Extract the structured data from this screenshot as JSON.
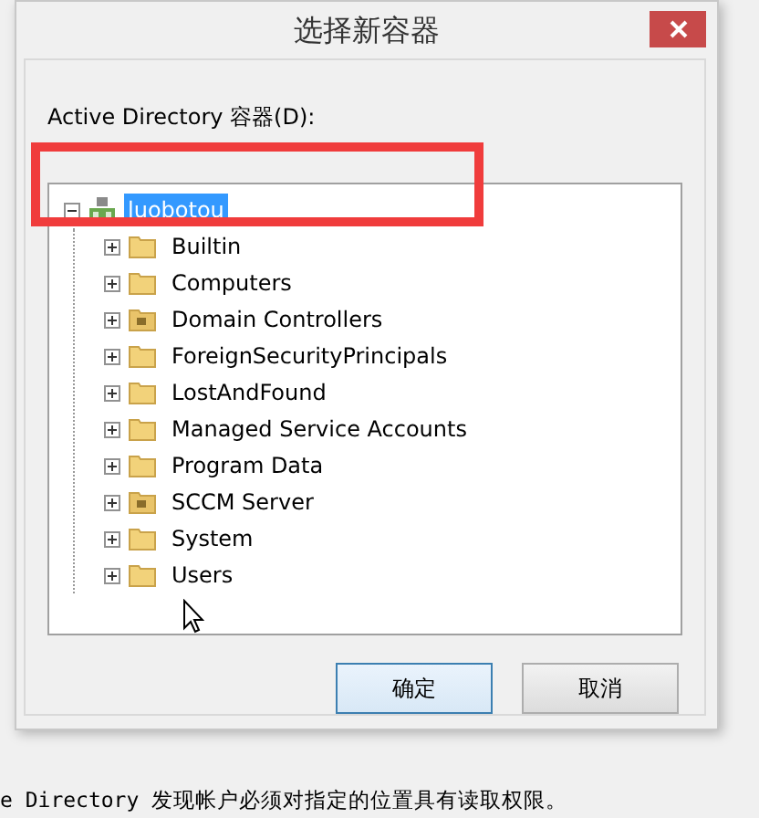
{
  "window": {
    "title": "选择新容器"
  },
  "label": "Active Directory 容器(D):",
  "tree": {
    "label": "luobotou",
    "selected": true,
    "expanded": true,
    "kind": "domain",
    "children": [
      {
        "label": "Builtin",
        "kind": "container",
        "expanded": false,
        "selected": false
      },
      {
        "label": "Computers",
        "kind": "container",
        "expanded": false,
        "selected": false
      },
      {
        "label": "Domain Controllers",
        "kind": "ou",
        "expanded": false,
        "selected": false
      },
      {
        "label": "ForeignSecurityPrincipals",
        "kind": "container",
        "expanded": false,
        "selected": false
      },
      {
        "label": "LostAndFound",
        "kind": "container",
        "expanded": false,
        "selected": false
      },
      {
        "label": "Managed Service Accounts",
        "kind": "container",
        "expanded": false,
        "selected": false
      },
      {
        "label": "Program Data",
        "kind": "container",
        "expanded": false,
        "selected": false
      },
      {
        "label": "SCCM Server",
        "kind": "ou",
        "expanded": false,
        "selected": false
      },
      {
        "label": "System",
        "kind": "container",
        "expanded": false,
        "selected": false
      },
      {
        "label": "Users",
        "kind": "container",
        "expanded": false,
        "selected": false
      }
    ]
  },
  "buttons": [
    {
      "label": "确定",
      "default": true
    },
    {
      "label": "取消",
      "default": false
    }
  ],
  "background_text": "e Directory 发现帐户必须对指定的位置具有读取权限。"
}
